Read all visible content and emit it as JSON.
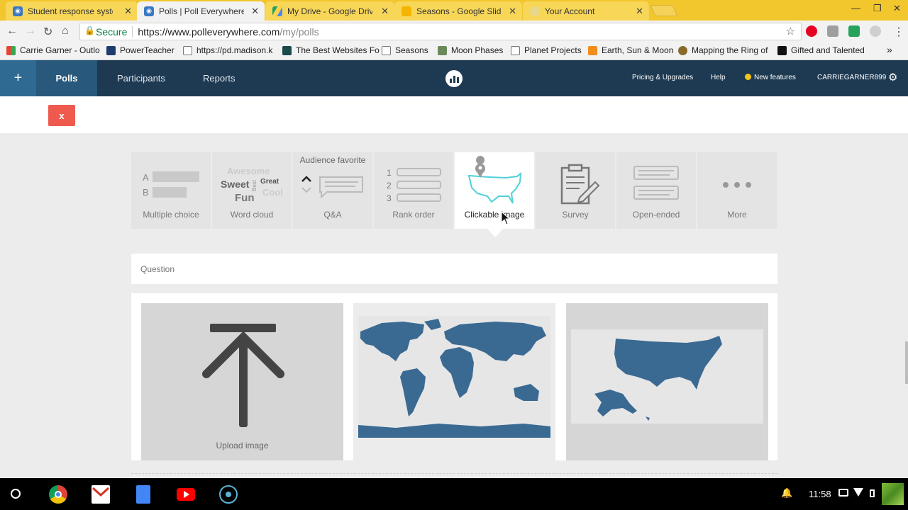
{
  "browser": {
    "tabs": [
      {
        "title": "Student response syster",
        "favicon": "pollev-icon",
        "color": "#3b78c2"
      },
      {
        "title": "Polls | Poll Everywhere",
        "favicon": "pollev-icon",
        "color": "#3b78c2"
      },
      {
        "title": "My Drive - Google Drive",
        "favicon": "drive-icon",
        "color": "#1fa463"
      },
      {
        "title": "Seasons - Google Slides",
        "favicon": "slides-icon",
        "color": "#f4b400"
      },
      {
        "title": "Your Account",
        "favicon": "account-icon",
        "color": "#e0c070"
      }
    ],
    "secure_label": "Secure",
    "url_host": "https://www.polleverywhere.com",
    "url_path": "/my/polls",
    "bookmarks": [
      {
        "label": "Carrie Garner - Outlo",
        "icon": "apps-grid-icon"
      },
      {
        "label": "PowerTeacher",
        "icon": "powerteacher-icon"
      },
      {
        "label": "https://pd.madison.k",
        "icon": "page-icon"
      },
      {
        "label": "The Best Websites Fo",
        "icon": "edtech-icon"
      },
      {
        "label": "Seasons",
        "icon": "page-icon"
      },
      {
        "label": "Moon Phases",
        "icon": "moon-icon"
      },
      {
        "label": "Planet Projects",
        "icon": "page-icon"
      },
      {
        "label": "Earth, Sun & Moon",
        "icon": "t-icon"
      },
      {
        "label": "Mapping the Ring of",
        "icon": "shield-icon"
      },
      {
        "label": "Gifted and Talented",
        "icon": "h-icon"
      }
    ],
    "overflow_label": "»"
  },
  "app": {
    "plus_label": "+",
    "nav": [
      {
        "label": "Polls",
        "active": true
      },
      {
        "label": "Participants",
        "active": false
      },
      {
        "label": "Reports",
        "active": false
      }
    ],
    "right_nav": {
      "pricing": "Pricing & Upgrades",
      "help": "Help",
      "new_features": "New features",
      "username": "CARRIEGARNER899"
    },
    "close_label": "x",
    "types": [
      {
        "label": "Multiple choice",
        "icon": "multiple-choice-icon",
        "active": false
      },
      {
        "label": "Word cloud",
        "icon": "word-cloud-icon",
        "active": false
      },
      {
        "label": "Q&A",
        "icon": "qa-icon",
        "active": false
      },
      {
        "label": "Rank order",
        "icon": "rank-order-icon",
        "active": false
      },
      {
        "label": "Clickable image",
        "icon": "map-pin-icon",
        "active": true
      },
      {
        "label": "Survey",
        "icon": "clipboard-icon",
        "active": false
      },
      {
        "label": "Open-ended",
        "icon": "open-ended-icon",
        "active": false
      },
      {
        "label": "More",
        "icon": "more-dots-icon",
        "active": false
      }
    ],
    "mc_letters": {
      "a": "A",
      "b": "B"
    },
    "wordcloud_words": {
      "w1": "Awesome",
      "w2": "Sweet",
      "w3": "Best",
      "w4": "Great",
      "w5": "Fun",
      "w6": "Cool"
    },
    "qa_badge": "Audience favorite",
    "rank_numbers": [
      "1",
      "2",
      "3"
    ],
    "question_placeholder": "Question",
    "upload_label": "Upload image",
    "colors": {
      "nav_bg": "#1e3a52",
      "nav_active": "#28587b",
      "close": "#ef5a4f",
      "map": "#3a6a92",
      "accent_teal": "#4fd1d9"
    }
  },
  "taskbar": {
    "time": "11:58"
  }
}
